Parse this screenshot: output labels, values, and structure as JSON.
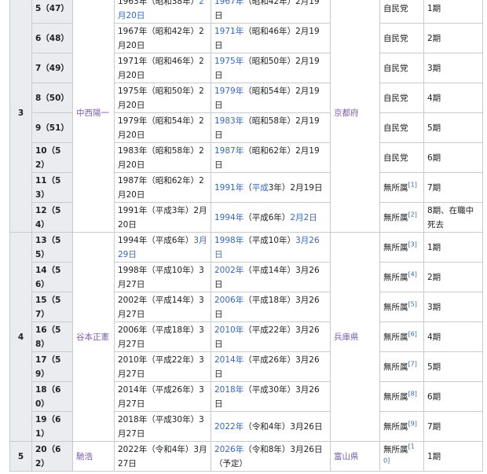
{
  "groups": [
    {
      "gen": "3",
      "name": "中西陽一",
      "pref": "京都府",
      "terms": [
        {
          "term": "5（47）",
          "start": "1963年（昭和38年）",
          "start_link": "2月20日",
          "end_link": "1967年",
          "end_rest": "（昭和42年）2月19日",
          "end_rest_link": "",
          "end_tail": "",
          "end_note": "",
          "party": "自民党",
          "ref": "",
          "period": "1期"
        },
        {
          "term": "6（48）",
          "start": "1967年（昭和42年）2月20日",
          "start_link": "",
          "end_link": "1971年",
          "end_rest": "（昭和46年）2月19日",
          "end_rest_link": "",
          "end_tail": "",
          "end_note": "",
          "party": "自民党",
          "ref": "",
          "period": "2期"
        },
        {
          "term": "7（49）",
          "start": "1971年（昭和46年）2月20日",
          "start_link": "",
          "end_link": "1975年",
          "end_rest": "（昭和50年）2月19日",
          "end_rest_link": "",
          "end_tail": "",
          "end_note": "",
          "party": "自民党",
          "ref": "",
          "period": "3期"
        },
        {
          "term": "8（50）",
          "start": "1975年（昭和50年）2月20日",
          "start_link": "",
          "end_link": "1979年",
          "end_rest": "（昭和54年）2月19日",
          "end_rest_link": "",
          "end_tail": "",
          "end_note": "",
          "party": "自民党",
          "ref": "",
          "period": "4期"
        },
        {
          "term": "9（51）",
          "start": "1979年（昭和54年）2月20日",
          "start_link": "",
          "end_link": "1983年",
          "end_rest": "（昭和58年）2月19日",
          "end_rest_link": "",
          "end_tail": "",
          "end_note": "",
          "party": "自民党",
          "ref": "",
          "period": "5期"
        },
        {
          "term": "10（52）",
          "start": "1983年（昭和58年）2月20日",
          "start_link": "",
          "end_link": "1987年",
          "end_rest": "（昭和62年）2月19日",
          "end_rest_link": "",
          "end_tail": "",
          "end_note": "",
          "party": "自民党",
          "ref": "",
          "period": "6期"
        },
        {
          "term": "11（53）",
          "start": "1987年（昭和62年）2月20日",
          "start_link": "",
          "end_link": "1991年",
          "end_rest": "（",
          "end_rest_link": "平成",
          "end_tail": "3年）2月19日",
          "end_note": "",
          "party": "無所属",
          "ref": "[1]",
          "period": "7期"
        },
        {
          "term": "12（54）",
          "start": "1991年（平成3年）2月20日",
          "start_link": "",
          "end_link": "1994年",
          "end_rest": "（平成6年）",
          "end_rest_link": "2月2日",
          "end_tail": "",
          "end_note": "",
          "party": "無所属",
          "ref": "[2]",
          "period": "8期、在職中死去"
        }
      ]
    },
    {
      "gen": "4",
      "name": "谷本正憲",
      "pref": "兵庫県",
      "terms": [
        {
          "term": "13（55）",
          "start": "1994年（平成6年）",
          "start_link": "3月29日",
          "end_link": "1998年",
          "end_rest": "（平成10年）",
          "end_rest_link": "3月26日",
          "end_tail": "",
          "end_note": "",
          "party": "無所属",
          "ref": "[3]",
          "period": "1期"
        },
        {
          "term": "14（56）",
          "start": "1998年（平成10年）3月27日",
          "start_link": "",
          "end_link": "2002年",
          "end_rest": "（平成14年）3月26日",
          "end_rest_link": "",
          "end_tail": "",
          "end_note": "",
          "party": "無所属",
          "ref": "[4]",
          "period": "2期"
        },
        {
          "term": "15（57）",
          "start": "2002年（平成14年）3月27日",
          "start_link": "",
          "end_link": "2006年",
          "end_rest": "（平成18年）3月26日",
          "end_rest_link": "",
          "end_tail": "",
          "end_note": "",
          "party": "無所属",
          "ref": "[5]",
          "period": "3期"
        },
        {
          "term": "16（58）",
          "start": "2006年（平成18年）3月27日",
          "start_link": "",
          "end_link": "2010年",
          "end_rest": "（平成22年）3月26日",
          "end_rest_link": "",
          "end_tail": "",
          "end_note": "",
          "party": "無所属",
          "ref": "[6]",
          "period": "4期"
        },
        {
          "term": "17（59）",
          "start": "2010年（平成22年）3月27日",
          "start_link": "",
          "end_link": "2014年",
          "end_rest": "（平成26年）3月26日",
          "end_rest_link": "",
          "end_tail": "",
          "end_note": "",
          "party": "無所属",
          "ref": "[7]",
          "period": "5期"
        },
        {
          "term": "18（60）",
          "start": "2014年（平成26年）3月27日",
          "start_link": "",
          "end_link": "2018年",
          "end_rest": "（平成30年）3月26日",
          "end_rest_link": "",
          "end_tail": "",
          "end_note": "",
          "party": "無所属",
          "ref": "[8]",
          "period": "6期"
        },
        {
          "term": "19（61）",
          "start": "2018年（平成30年）3月27日",
          "start_link": "",
          "end_link": "2022年",
          "end_rest": "（令和4年）3月26日",
          "end_rest_link": "",
          "end_tail": "",
          "end_note": "",
          "party": "無所属",
          "ref": "[9]",
          "period": "7期"
        }
      ]
    },
    {
      "gen": "5",
      "name": "馳浩",
      "pref": "富山県",
      "terms": [
        {
          "term": "20（62）",
          "start": "2022年（令和4年）3月27日",
          "start_link": "",
          "end_link": "2026年",
          "end_rest": "（令和8年）3月26日",
          "end_rest_link": "",
          "end_tail": "",
          "end_note": "（予定）",
          "party": "無所属",
          "ref": "[10]",
          "period": "1期"
        }
      ]
    }
  ]
}
